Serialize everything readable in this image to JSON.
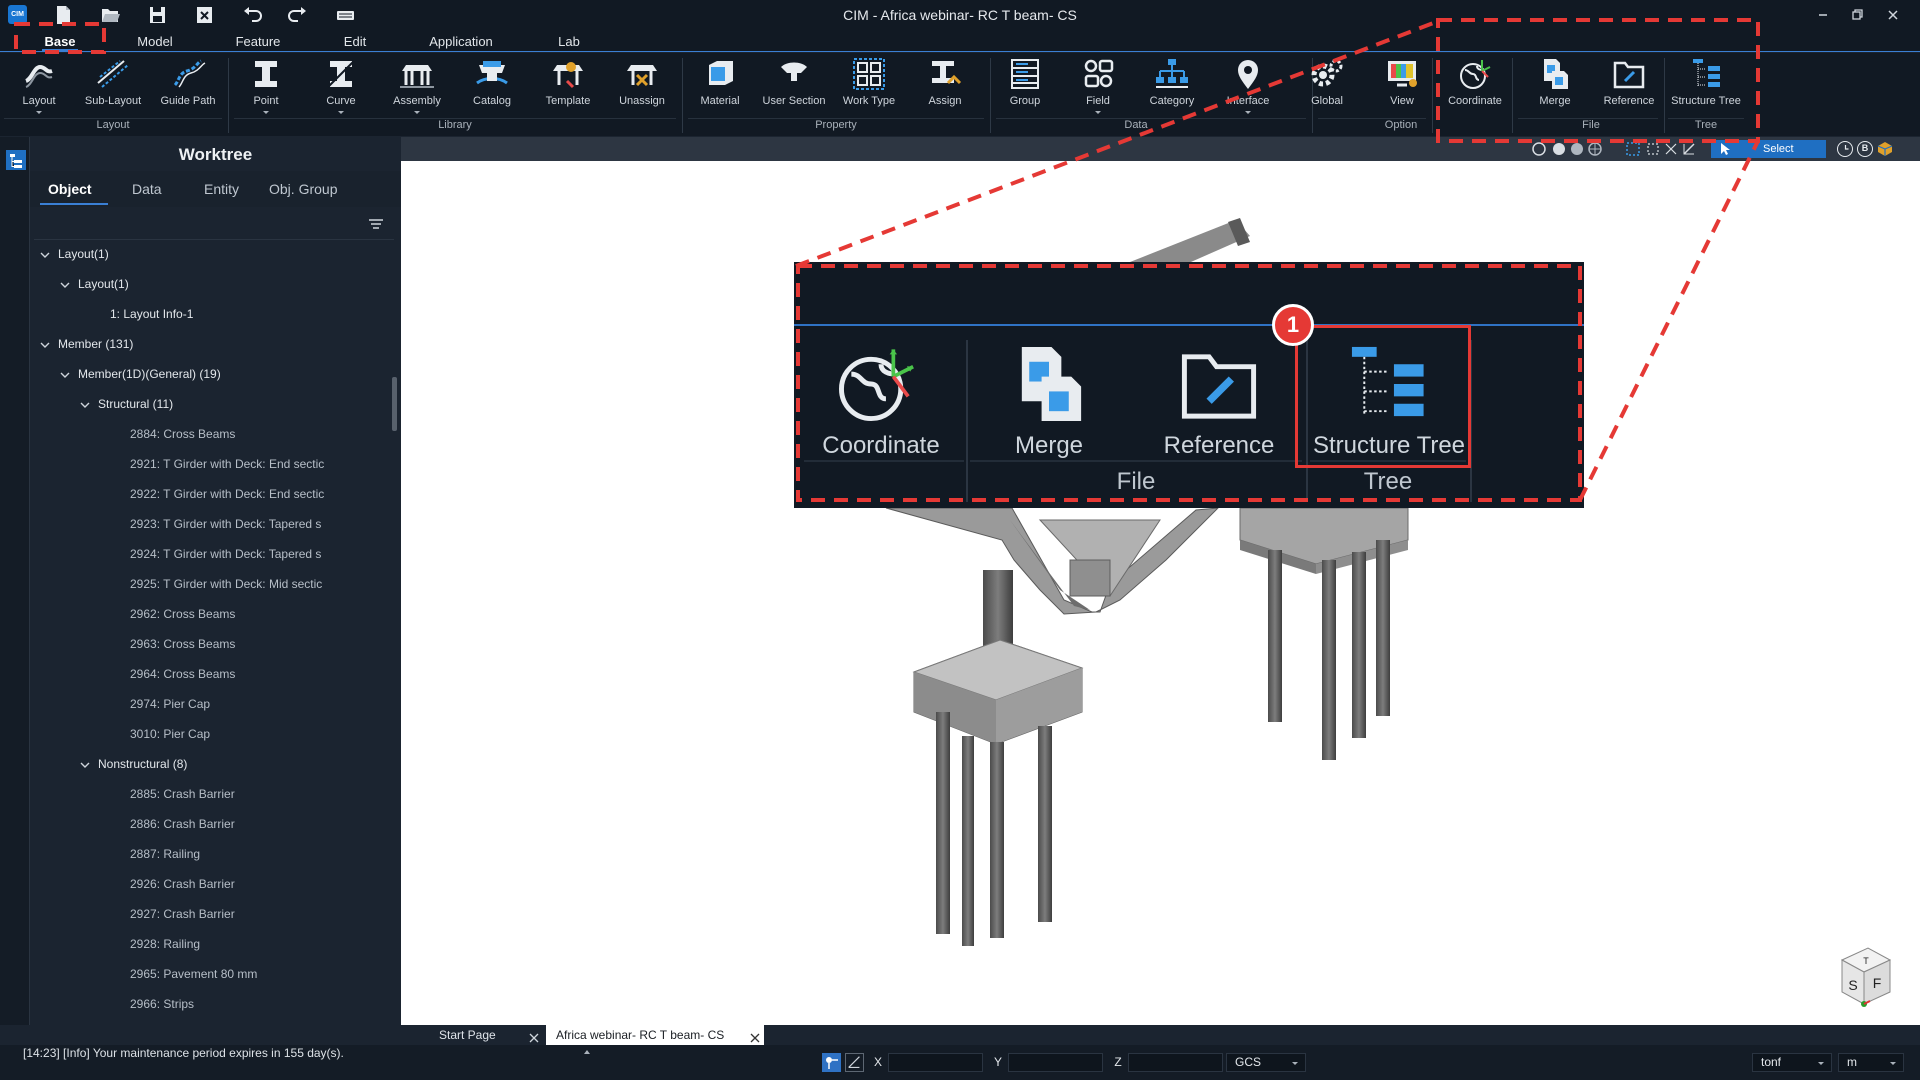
{
  "app": {
    "logo_text": "CIM",
    "title": "CIM - Africa webinar- RC T beam- CS"
  },
  "quick_access": [
    "new-file-icon",
    "open-file-icon",
    "save-icon",
    "close-file-icon",
    "undo-icon",
    "redo-icon",
    "keyboard-icon"
  ],
  "menu_tabs": [
    {
      "label": "Base",
      "active": true
    },
    {
      "label": "Model"
    },
    {
      "label": "Feature"
    },
    {
      "label": "Edit"
    },
    {
      "label": "Application"
    },
    {
      "label": "Lab"
    }
  ],
  "ribbon": {
    "buttons": [
      {
        "label": "Layout",
        "icon": "layout-icon",
        "dropdown": true
      },
      {
        "label": "Sub-Layout",
        "icon": "sub-layout-icon"
      },
      {
        "label": "Guide Path",
        "icon": "guide-path-icon"
      },
      {
        "label": "Point",
        "icon": "point-icon",
        "dropdown": true
      },
      {
        "label": "Curve",
        "icon": "curve-icon",
        "dropdown": true
      },
      {
        "label": "Assembly",
        "icon": "assembly-icon",
        "dropdown": true
      },
      {
        "label": "Catalog",
        "icon": "catalog-icon"
      },
      {
        "label": "Template",
        "icon": "template-icon"
      },
      {
        "label": "Unassign",
        "icon": "unassign-icon"
      },
      {
        "label": "Material",
        "icon": "material-icon"
      },
      {
        "label": "User Section",
        "icon": "user-section-icon"
      },
      {
        "label": "Work Type",
        "icon": "work-type-icon"
      },
      {
        "label": "Assign",
        "icon": "assign-icon"
      },
      {
        "label": "Group",
        "icon": "group-icon"
      },
      {
        "label": "Field",
        "icon": "field-icon",
        "dropdown": true
      },
      {
        "label": "Category",
        "icon": "category-icon"
      },
      {
        "label": "Interface",
        "icon": "interface-icon",
        "dropdown": true
      },
      {
        "label": "Global",
        "icon": "global-icon"
      },
      {
        "label": "View",
        "icon": "view-icon"
      },
      {
        "label": "Coordinate",
        "icon": "coordinate-icon"
      },
      {
        "label": "Merge",
        "icon": "merge-icon"
      },
      {
        "label": "Reference",
        "icon": "reference-icon"
      },
      {
        "label": "Structure Tree",
        "icon": "structure-tree-icon"
      }
    ],
    "groups": [
      "Layout",
      "Library",
      "Property",
      "Data",
      "Option",
      "File",
      "Tree"
    ]
  },
  "worktree": {
    "title": "Worktree",
    "tabs": [
      {
        "label": "Object",
        "active": true
      },
      {
        "label": "Data"
      },
      {
        "label": "Entity"
      },
      {
        "label": "Obj. Group"
      }
    ],
    "items": [
      {
        "label": "Layout(1)",
        "level": 0,
        "expanded": true
      },
      {
        "label": "Layout(1)",
        "level": 1,
        "expanded": true
      },
      {
        "label": "1: Layout Info-1",
        "level": 2,
        "leaf": true,
        "bright": true
      },
      {
        "label": "Member (131)",
        "level": 0,
        "expanded": true
      },
      {
        "label": "Member(1D)(General) (19)",
        "level": 1,
        "expanded": true
      },
      {
        "label": "Structural (11)",
        "level": 2,
        "expanded": true
      },
      {
        "label": "2884: Cross Beams",
        "level": 3,
        "leaf": true
      },
      {
        "label": "2921: T Girder with Deck: End sectic",
        "level": 3,
        "leaf": true
      },
      {
        "label": "2922: T Girder with Deck: End sectic",
        "level": 3,
        "leaf": true
      },
      {
        "label": "2923: T Girder with Deck: Tapered s",
        "level": 3,
        "leaf": true
      },
      {
        "label": "2924: T Girder with Deck: Tapered s",
        "level": 3,
        "leaf": true
      },
      {
        "label": "2925: T Girder with Deck: Mid sectic",
        "level": 3,
        "leaf": true
      },
      {
        "label": "2962: Cross Beams",
        "level": 3,
        "leaf": true
      },
      {
        "label": "2963: Cross Beams",
        "level": 3,
        "leaf": true
      },
      {
        "label": "2964: Cross Beams",
        "level": 3,
        "leaf": true
      },
      {
        "label": "2974: Pier Cap",
        "level": 3,
        "leaf": true
      },
      {
        "label": "3010: Pier Cap",
        "level": 3,
        "leaf": true
      },
      {
        "label": "Nonstructural (8)",
        "level": 2,
        "expanded": true
      },
      {
        "label": "2885: Crash Barrier",
        "level": 3,
        "leaf": true
      },
      {
        "label": "2886: Crash Barrier",
        "level": 3,
        "leaf": true
      },
      {
        "label": "2887: Railing",
        "level": 3,
        "leaf": true
      },
      {
        "label": "2926: Crash Barrier",
        "level": 3,
        "leaf": true
      },
      {
        "label": "2927: Crash Barrier",
        "level": 3,
        "leaf": true
      },
      {
        "label": "2928: Railing",
        "level": 3,
        "leaf": true
      },
      {
        "label": "2965: Pavement 80 mm",
        "level": 3,
        "leaf": true
      },
      {
        "label": "2966: Strips",
        "level": 3,
        "leaf": true
      }
    ]
  },
  "viewport": {
    "select_label": "Select",
    "view_cube": {
      "left": "S",
      "right": "F",
      "top": "T"
    }
  },
  "callout": {
    "buttons": [
      {
        "label": "Coordinate",
        "icon": "coordinate-icon"
      },
      {
        "label": "Merge",
        "icon": "merge-icon"
      },
      {
        "label": "Reference",
        "icon": "reference-icon"
      },
      {
        "label": "Structure Tree",
        "icon": "structure-tree-icon"
      }
    ],
    "groups": [
      "File",
      "Tree"
    ],
    "badge": "1"
  },
  "doc_tabs": [
    {
      "label": "Start Page",
      "active": false
    },
    {
      "label": "Africa webinar- RC T beam- CS",
      "active": true
    }
  ],
  "status": {
    "message": "[14:23] [Info] Your maintenance period expires in 155 day(s).",
    "coord_labels": [
      "X",
      "Y",
      "Z"
    ],
    "coord_values": [
      "",
      "",
      ""
    ],
    "coord_system": "GCS",
    "force_unit": "tonf",
    "length_unit": "m"
  },
  "colors": {
    "accent": "#3a7fd4",
    "highlight": "#e53935",
    "bg": "#1b2430"
  }
}
